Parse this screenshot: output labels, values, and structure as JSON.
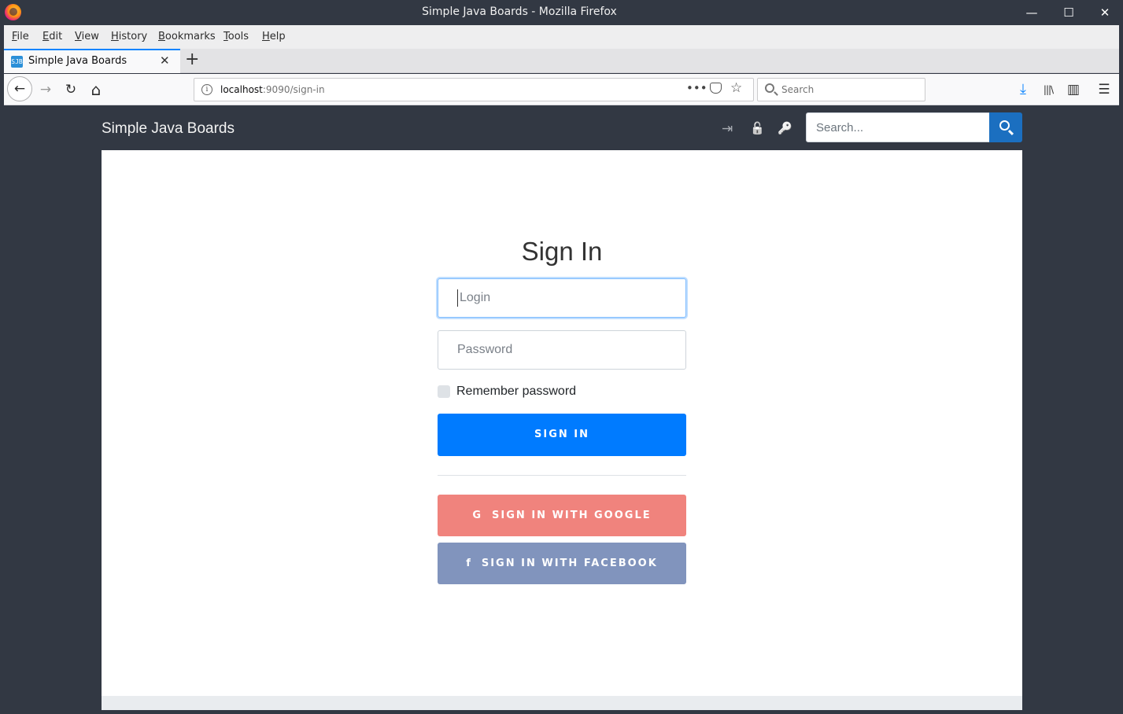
{
  "window": {
    "title": "Simple Java Boards - Mozilla Firefox",
    "controls": {
      "minimize": "—",
      "maximize": "☐",
      "close": "✕"
    }
  },
  "menu": {
    "items": [
      {
        "accel": "F",
        "rest": "ile"
      },
      {
        "accel": "E",
        "rest": "dit"
      },
      {
        "accel": "V",
        "rest": "iew"
      },
      {
        "accel": "H",
        "rest": "istory"
      },
      {
        "accel": "B",
        "rest": "ookmarks"
      },
      {
        "accel": "T",
        "rest": "ools"
      },
      {
        "accel": "H",
        "rest": "elp"
      }
    ]
  },
  "tab": {
    "title": "Simple Java Boards",
    "favicon_text": "SJB",
    "close": "✕",
    "new_tab": "+"
  },
  "nav": {
    "back": "←",
    "forward": "→",
    "reload": "↻",
    "home": "⌂",
    "url_host": "localhost",
    "url_rest": ":9090/sign-in",
    "info": "i",
    "page_actions": "•••",
    "bookmark": "☆",
    "search_placeholder": "Search",
    "downloads": "⤓",
    "library": "|||\\",
    "sidebar": "▥",
    "menu": "☰"
  },
  "site": {
    "brand": "Simple Java Boards",
    "header_icons": {
      "sign_in": "⇥",
      "lock": "🔓",
      "key": "🔑"
    },
    "search_placeholder": "Search..."
  },
  "signin": {
    "title": "Sign In",
    "login_placeholder": "Login",
    "password_placeholder": "Password",
    "remember_label": "Remember password",
    "submit_label": "SIGN IN",
    "google_icon": "G",
    "google_label": "SIGN IN WITH GOOGLE",
    "facebook_icon": "f",
    "facebook_label": "SIGN IN WITH FACEBOOK"
  },
  "colors": {
    "primary": "#007bff",
    "google": "#f0837d",
    "facebook": "#8194bd",
    "header_bg": "#323843"
  }
}
